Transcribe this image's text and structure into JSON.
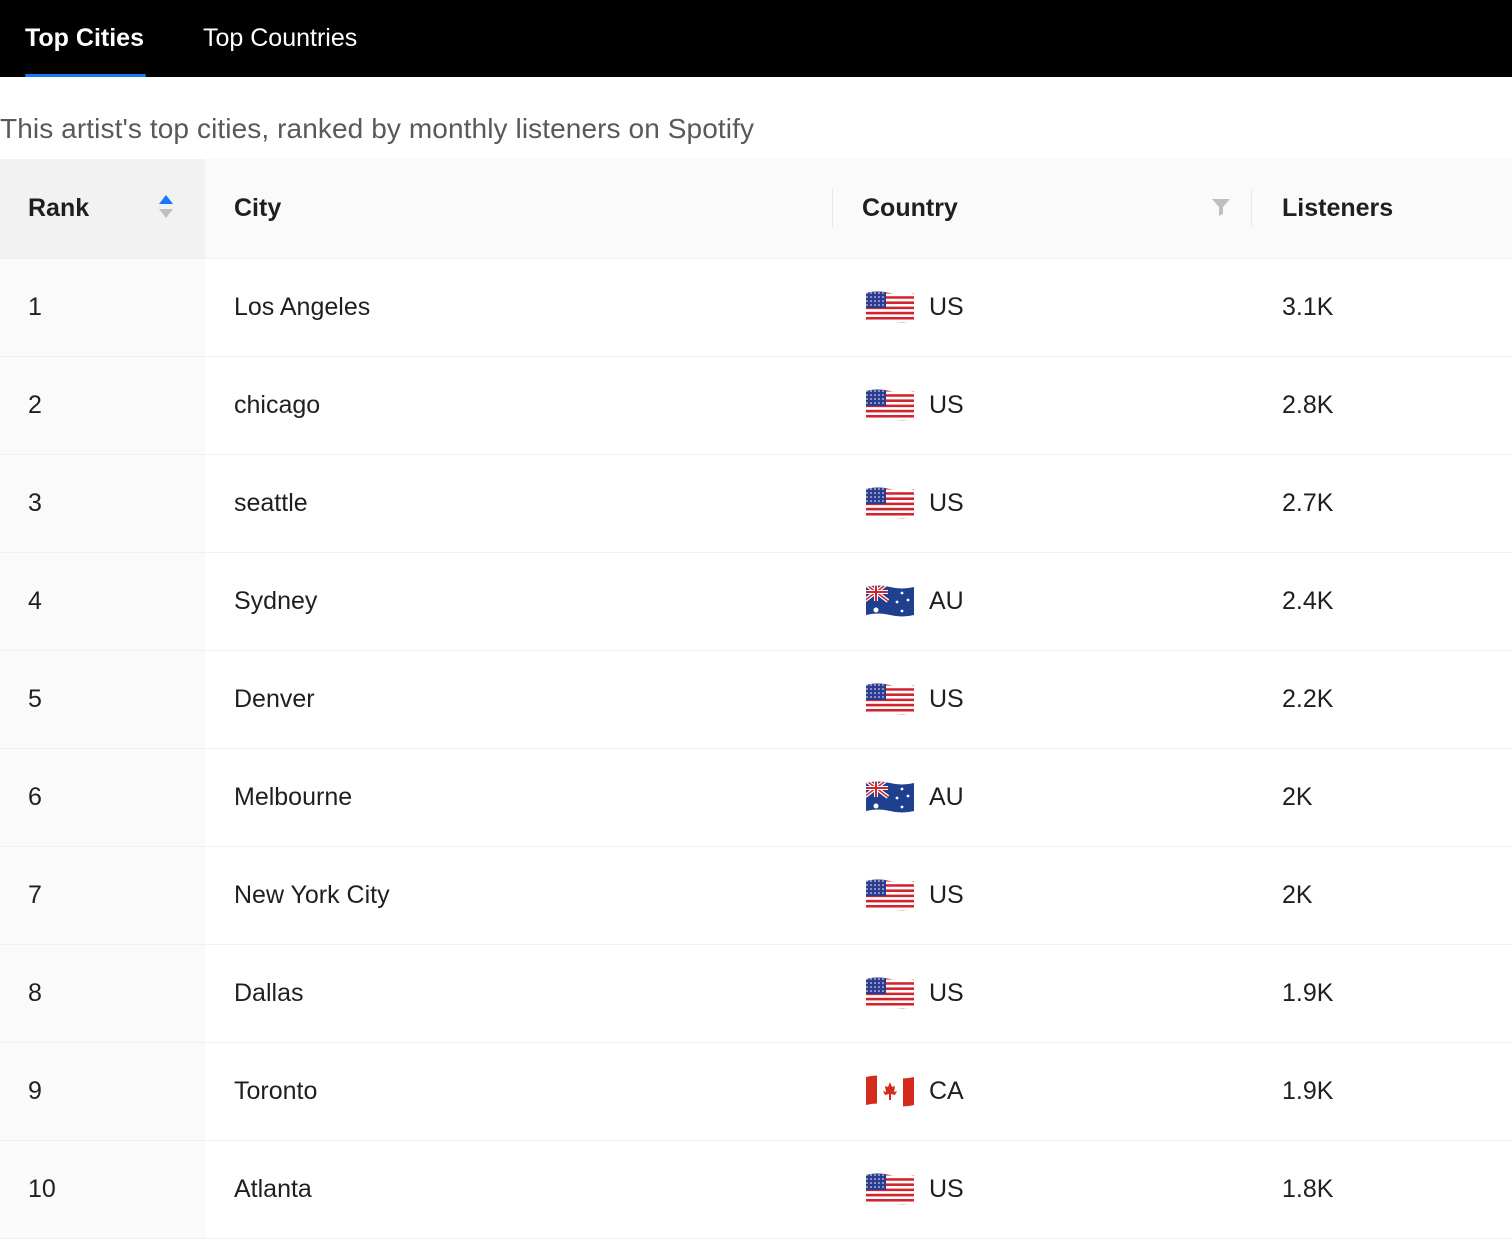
{
  "tabs": [
    {
      "label": "Top Cities",
      "active": true
    },
    {
      "label": "Top Countries",
      "active": false
    }
  ],
  "subtitle": "This artist's top cities, ranked by monthly listeners on Spotify",
  "table": {
    "columns": {
      "rank": "Rank",
      "city": "City",
      "country": "Country",
      "listeners": "Listeners"
    },
    "sort": {
      "column": "rank",
      "direction": "ascending"
    },
    "rows": [
      {
        "rank": "1",
        "city": "Los Angeles",
        "flag": "us-flag-icon",
        "country": "US",
        "listeners": "3.1K"
      },
      {
        "rank": "2",
        "city": "chicago",
        "flag": "us-flag-icon",
        "country": "US",
        "listeners": "2.8K"
      },
      {
        "rank": "3",
        "city": "seattle",
        "flag": "us-flag-icon",
        "country": "US",
        "listeners": "2.7K"
      },
      {
        "rank": "4",
        "city": "Sydney",
        "flag": "au-flag-icon",
        "country": "AU",
        "listeners": "2.4K"
      },
      {
        "rank": "5",
        "city": "Denver",
        "flag": "us-flag-icon",
        "country": "US",
        "listeners": "2.2K"
      },
      {
        "rank": "6",
        "city": "Melbourne",
        "flag": "au-flag-icon",
        "country": "AU",
        "listeners": "2K"
      },
      {
        "rank": "7",
        "city": "New York City",
        "flag": "us-flag-icon",
        "country": "US",
        "listeners": "2K"
      },
      {
        "rank": "8",
        "city": "Dallas",
        "flag": "us-flag-icon",
        "country": "US",
        "listeners": "1.9K"
      },
      {
        "rank": "9",
        "city": "Toronto",
        "flag": "ca-flag-icon",
        "country": "CA",
        "listeners": "1.9K"
      },
      {
        "rank": "10",
        "city": "Atlanta",
        "flag": "us-flag-icon",
        "country": "US",
        "listeners": "1.8K"
      }
    ]
  },
  "colors": {
    "tabbar_bg": "#000000",
    "active_underline": "#1677ff",
    "sort_active": "#1677ff",
    "sort_inactive": "#bfbfbf",
    "header_bg": "#fafafa"
  }
}
